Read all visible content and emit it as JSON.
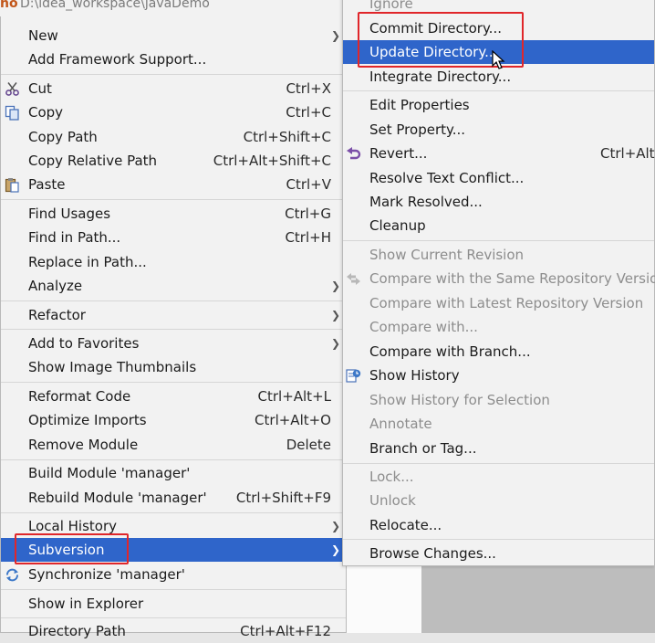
{
  "header": {
    "logo_text": "no",
    "path": "D:\\idea_workspace\\javaDemo"
  },
  "left_menu": {
    "new": "New",
    "add_framework": "Add Framework Support...",
    "cut": "Cut",
    "cut_sc": "Ctrl+X",
    "copy": "Copy",
    "copy_sc": "Ctrl+C",
    "copy_path": "Copy Path",
    "copy_path_sc": "Ctrl+Shift+C",
    "copy_rel": "Copy Relative Path",
    "copy_rel_sc": "Ctrl+Alt+Shift+C",
    "paste": "Paste",
    "paste_sc": "Ctrl+V",
    "find_usages": "Find Usages",
    "find_usages_sc": "Ctrl+G",
    "find_in_path": "Find in Path...",
    "find_in_path_sc": "Ctrl+H",
    "replace_in_path": "Replace in Path...",
    "analyze": "Analyze",
    "refactor": "Refactor",
    "add_favorites": "Add to Favorites",
    "show_thumbs": "Show Image Thumbnails",
    "reformat": "Reformat Code",
    "reformat_sc": "Ctrl+Alt+L",
    "optimize": "Optimize Imports",
    "optimize_sc": "Ctrl+Alt+O",
    "remove_module": "Remove Module",
    "remove_module_sc": "Delete",
    "build_module": "Build Module 'manager'",
    "rebuild_module": "Rebuild Module 'manager'",
    "rebuild_module_sc": "Ctrl+Shift+F9",
    "local_history": "Local History",
    "subversion": "Subversion",
    "synchronize": "Synchronize 'manager'",
    "show_explorer": "Show in Explorer",
    "directory_path": "Directory Path",
    "directory_path_sc": "Ctrl+Alt+F12"
  },
  "right_menu": {
    "ignore": "Ignore",
    "commit_dir": "Commit Directory...",
    "update_dir": "Update Directory...",
    "integrate_dir": "Integrate Directory...",
    "edit_props": "Edit Properties",
    "set_prop": "Set Property...",
    "revert": "Revert...",
    "revert_sc": "Ctrl+Alt+",
    "resolve_conflict": "Resolve Text Conflict...",
    "mark_resolved": "Mark Resolved...",
    "cleanup": "Cleanup",
    "show_current_rev": "Show Current Revision",
    "compare_same": "Compare with the Same Repository Version",
    "compare_latest": "Compare with Latest Repository Version",
    "compare_with": "Compare with...",
    "compare_branch": "Compare with Branch...",
    "show_history": "Show History",
    "show_history_sel": "Show History for Selection",
    "annotate": "Annotate",
    "branch_tag": "Branch or Tag...",
    "lock": "Lock...",
    "unlock": "Unlock",
    "relocate": "Relocate...",
    "browse_changes": "Browse Changes..."
  },
  "colors": {
    "menu_bg": "#f2f2f2",
    "selection": "#2f65ca",
    "highlight_box": "#e0262a",
    "disabled_text": "#8d8d8d"
  }
}
